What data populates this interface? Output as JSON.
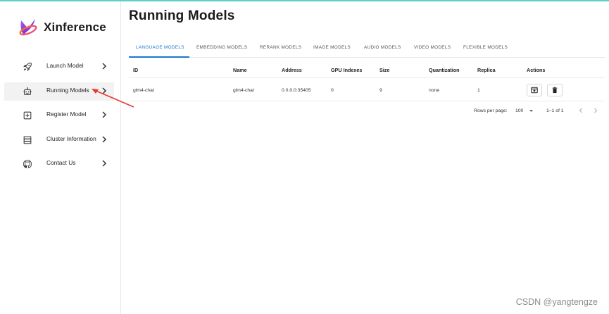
{
  "app": {
    "name": "Xinference",
    "brand_color": "#7c3aed",
    "accent_color": "#1976d2"
  },
  "sidebar": {
    "items": [
      {
        "label": "Launch Model",
        "icon": "rocket-icon"
      },
      {
        "label": "Running Models",
        "icon": "robot-icon",
        "active": true
      },
      {
        "label": "Register Model",
        "icon": "add-box-icon"
      },
      {
        "label": "Cluster Information",
        "icon": "storage-icon"
      },
      {
        "label": "Contact Us",
        "icon": "github-icon"
      }
    ]
  },
  "main": {
    "title": "Running Models",
    "tabs": [
      {
        "label": "LANGUAGE MODELS",
        "active": true
      },
      {
        "label": "EMBEDDING MODELS"
      },
      {
        "label": "RERANK MODELS"
      },
      {
        "label": "IMAGE MODELS"
      },
      {
        "label": "AUDIO MODELS"
      },
      {
        "label": "VIDEO MODELS"
      },
      {
        "label": "FLEXIBLE MODELS"
      }
    ],
    "table": {
      "columns": [
        "ID",
        "Name",
        "Address",
        "GPU Indexes",
        "Size",
        "Quantization",
        "Replica",
        "Actions"
      ],
      "rows": [
        {
          "id": "glm4-chat",
          "name": "glm4-chat",
          "address": "0.0.0.0:35405",
          "gpu_indexes": "0",
          "size": "9",
          "quantization": "none",
          "replica": "1"
        }
      ]
    },
    "pagination": {
      "rows_per_page_label": "Rows per page:",
      "rows_per_page": "100",
      "range": "1–1 of 1"
    }
  },
  "watermark": "CSDN @yangtengze"
}
